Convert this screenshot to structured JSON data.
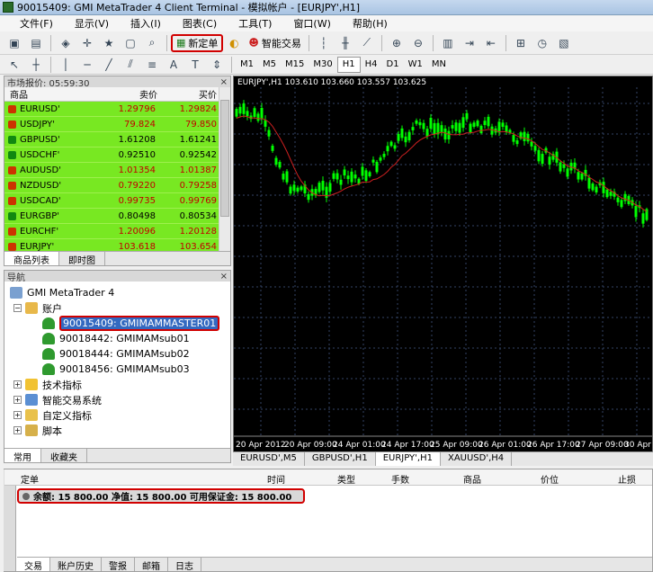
{
  "window": {
    "title": "90015409: GMI MetaTrader 4 Client Terminal - 模拟帐户 - [EURJPY',H1]"
  },
  "menu": [
    "文件(F)",
    "显示(V)",
    "插入(I)",
    "图表(C)",
    "工具(T)",
    "窗口(W)",
    "帮助(H)"
  ],
  "toolbar": {
    "new_order": "新定单",
    "expert_advisors": "智能交易"
  },
  "timeframes": [
    "M1",
    "M5",
    "M15",
    "M30",
    "H1",
    "H4",
    "D1",
    "W1",
    "MN"
  ],
  "active_timeframe": "H1",
  "market_watch": {
    "title": "市场报价: 05:59:30",
    "columns": {
      "symbol": "商品",
      "bid": "卖价",
      "ask": "买价"
    },
    "rows": [
      {
        "symbol": "EURUSD'",
        "bid": "1.29796",
        "ask": "1.29824"
      },
      {
        "symbol": "USDJPY'",
        "bid": "79.824",
        "ask": "79.850"
      },
      {
        "symbol": "GBPUSD'",
        "bid": "1.61208",
        "ask": "1.61241"
      },
      {
        "symbol": "USDCHF'",
        "bid": "0.92510",
        "ask": "0.92542"
      },
      {
        "symbol": "AUDUSD'",
        "bid": "1.01354",
        "ask": "1.01387"
      },
      {
        "symbol": "NZDUSD'",
        "bid": "0.79220",
        "ask": "0.79258"
      },
      {
        "symbol": "USDCAD'",
        "bid": "0.99735",
        "ask": "0.99769"
      },
      {
        "symbol": "EURGBP'",
        "bid": "0.80498",
        "ask": "0.80534"
      },
      {
        "symbol": "EURCHF'",
        "bid": "1.20096",
        "ask": "1.20128"
      },
      {
        "symbol": "EURJPY'",
        "bid": "103.618",
        "ask": "103.654"
      }
    ],
    "tabs": [
      "商品列表",
      "即时图"
    ]
  },
  "navigator": {
    "title": "导航",
    "root": "GMI MetaTrader 4",
    "accounts_label": "账户",
    "accounts": [
      "90015409: GMIMAMMASTER01",
      "90018442: GMIMAMsub01",
      "90018444: GMIMAMsub02",
      "90018456: GMIMAMsub03"
    ],
    "indicators": "技术指标",
    "experts": "智能交易系统",
    "custom": "自定义指标",
    "scripts": "脚本",
    "tabs": [
      "常用",
      "收藏夹"
    ]
  },
  "chart": {
    "label": "EURJPY',H1  103.610 103.660 103.557 103.625",
    "time_labels": [
      "20 Apr 2012",
      "20 Apr 09:00",
      "24 Apr 01:00",
      "24 Apr 17:00",
      "25 Apr 09:00",
      "26 Apr 01:00",
      "26 Apr 17:00",
      "27 Apr 09:00",
      "30 Apr"
    ],
    "tabs": [
      "EURUSD',M5",
      "GBPUSD',H1",
      "EURJPY',H1",
      "XAUUSD',H4"
    ],
    "active_tab": "EURJPY',H1",
    "colors": {
      "background": "#000000",
      "candle": "#00ff00",
      "ma": "#cc2020",
      "grid": "#334466"
    }
  },
  "terminal": {
    "columns": [
      "定单",
      "时间",
      "类型",
      "手数",
      "商品",
      "价位",
      "止损"
    ],
    "balance_line": "余额: 15 800.00  净值: 15 800.00  可用保证金: 15 800.00",
    "tabs": [
      "交易",
      "账户历史",
      "警报",
      "邮箱",
      "日志"
    ]
  }
}
